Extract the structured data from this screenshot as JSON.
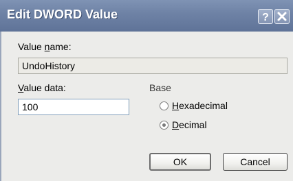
{
  "window": {
    "title": "Edit DWORD Value"
  },
  "titlebar_buttons": {
    "help": "help-icon",
    "close": "close-icon"
  },
  "value_name": {
    "label_pre": "Value ",
    "label_access": "n",
    "label_post": "ame:",
    "value": "UndoHistory"
  },
  "value_data": {
    "label_pre": "",
    "label_access": "V",
    "label_post": "alue data:",
    "value": "100"
  },
  "base": {
    "label": "Base",
    "options": [
      {
        "access": "H",
        "rest": "exadecimal",
        "checked": false
      },
      {
        "access": "D",
        "rest": "ecimal",
        "checked": true
      }
    ]
  },
  "buttons": {
    "ok": "OK",
    "cancel": "Cancel"
  },
  "colors": {
    "titlebar": "#6f83a6",
    "dialog_bg": "#ececea",
    "field_border": "#7f9db9"
  }
}
